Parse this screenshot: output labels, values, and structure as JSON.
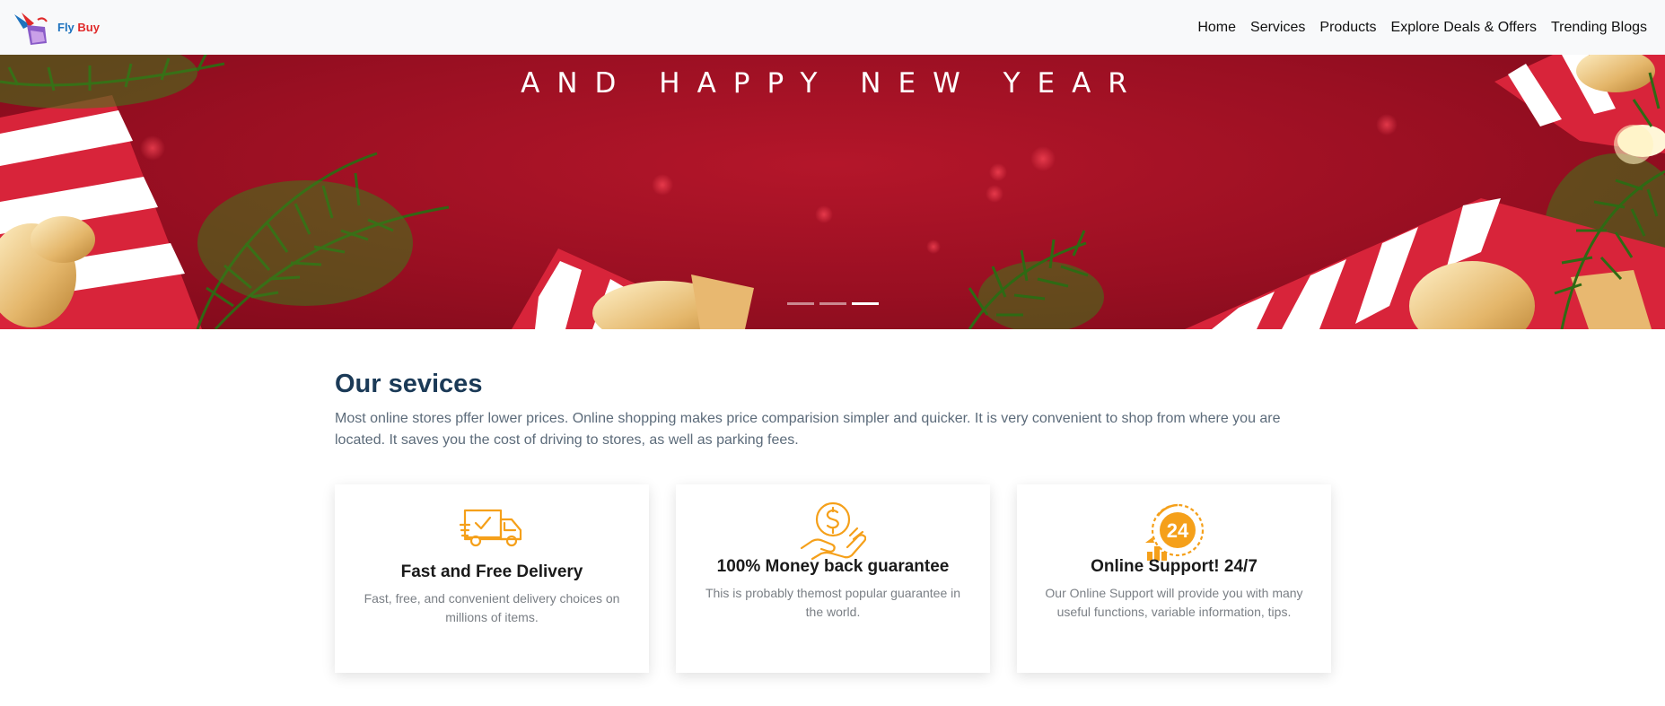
{
  "brand": {
    "name_part1": "Fly",
    "name_part2": "Buy"
  },
  "nav": {
    "items": [
      "Home",
      "Services",
      "Products",
      "Explore Deals & Offers",
      "Trending Blogs"
    ]
  },
  "hero": {
    "title": "AND HAPPY NEW YEAR",
    "slide_count": 3,
    "active_slide": 3
  },
  "services": {
    "heading": "Our sevices",
    "description": "Most online stores pffer lower prices. Online shopping makes price comparision simpler and quicker. It is very convenient to shop from where you are located. It saves you the cost of driving to stores, as well as parking fees.",
    "cards": [
      {
        "icon": "delivery-truck-icon",
        "title": "Fast and Free Delivery",
        "text": "Fast, free, and convenient delivery choices on millions of items."
      },
      {
        "icon": "money-back-icon",
        "title": "100% Money back guarantee",
        "text": "This is probably themost popular guarantee in the world."
      },
      {
        "icon": "support-24-icon",
        "title": "Online Support! 24/7",
        "text": "Our Online Support will provide you with many useful functions, variable information, tips.",
        "badge": "24"
      }
    ]
  },
  "colors": {
    "accent": "#f5a01a",
    "heading": "#1b3a57",
    "hero_red": "#a0132a",
    "brand_blue": "#1e73be",
    "brand_red": "#e02a2a"
  }
}
